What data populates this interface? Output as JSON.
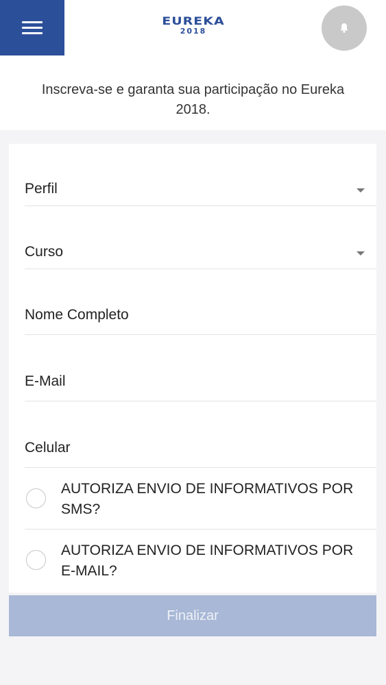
{
  "header": {
    "menu_icon": "hamburger-menu-icon",
    "logo": {
      "word": "EUREKA",
      "year": "2018"
    },
    "bell_icon": "bell-icon"
  },
  "intro_text": "Inscreva-se e garanta sua participação no Eureka 2018.",
  "form": {
    "perfil": {
      "label": "Perfil",
      "icon": "chevron-down-icon"
    },
    "curso": {
      "label": "Curso",
      "icon": "chevron-down-icon"
    },
    "nome": {
      "placeholder": "Nome Completo"
    },
    "email": {
      "placeholder": "E-Mail"
    },
    "celular": {
      "placeholder": "Celular"
    },
    "sms_opt": {
      "label": "AUTORIZA ENVIO DE INFORMATIVOS POR SMS?",
      "checked": false
    },
    "email_opt": {
      "label": "AUTORIZA ENVIO DE INFORMATIVOS POR E-MAIL?",
      "checked": false
    }
  },
  "finish_button": {
    "label": "Finalizar"
  },
  "colors": {
    "brand": "#2c4f9a",
    "button_disabled": "#a8b8d6",
    "bell_bg": "#c9c9c9"
  }
}
